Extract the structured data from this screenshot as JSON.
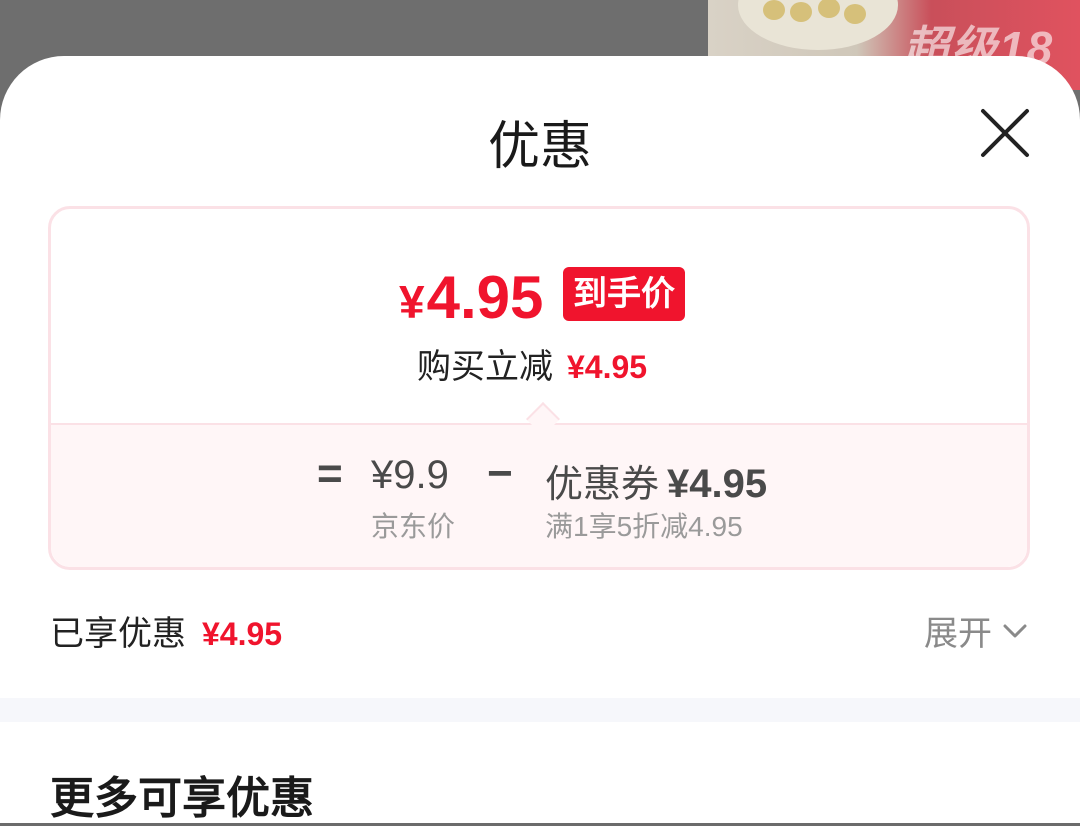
{
  "banner": {
    "text": "超级18"
  },
  "sheet": {
    "title": "优惠",
    "close_icon": "close-icon"
  },
  "summary": {
    "final_price_symbol": "¥",
    "final_price_value": "4.95",
    "final_price_tag": "到手价",
    "reduce_label": "购买立减",
    "reduce_value": "¥4.95"
  },
  "breakdown": {
    "equals": "=",
    "jd_price": "¥9.9",
    "jd_price_label": "京东价",
    "minus": "−",
    "coupon_label": "优惠券",
    "coupon_value": "¥4.95",
    "coupon_desc": "满1享5折减4.95"
  },
  "enjoyed": {
    "label": "已享优惠",
    "value": "¥4.95",
    "expand_label": "展开",
    "expand_icon": "chevron-down-icon"
  },
  "more": {
    "title": "更多可享优惠"
  },
  "colors": {
    "accent": "#f0142d",
    "card_border": "#fbe1e6",
    "card_bottom_bg": "#fff6f7"
  }
}
